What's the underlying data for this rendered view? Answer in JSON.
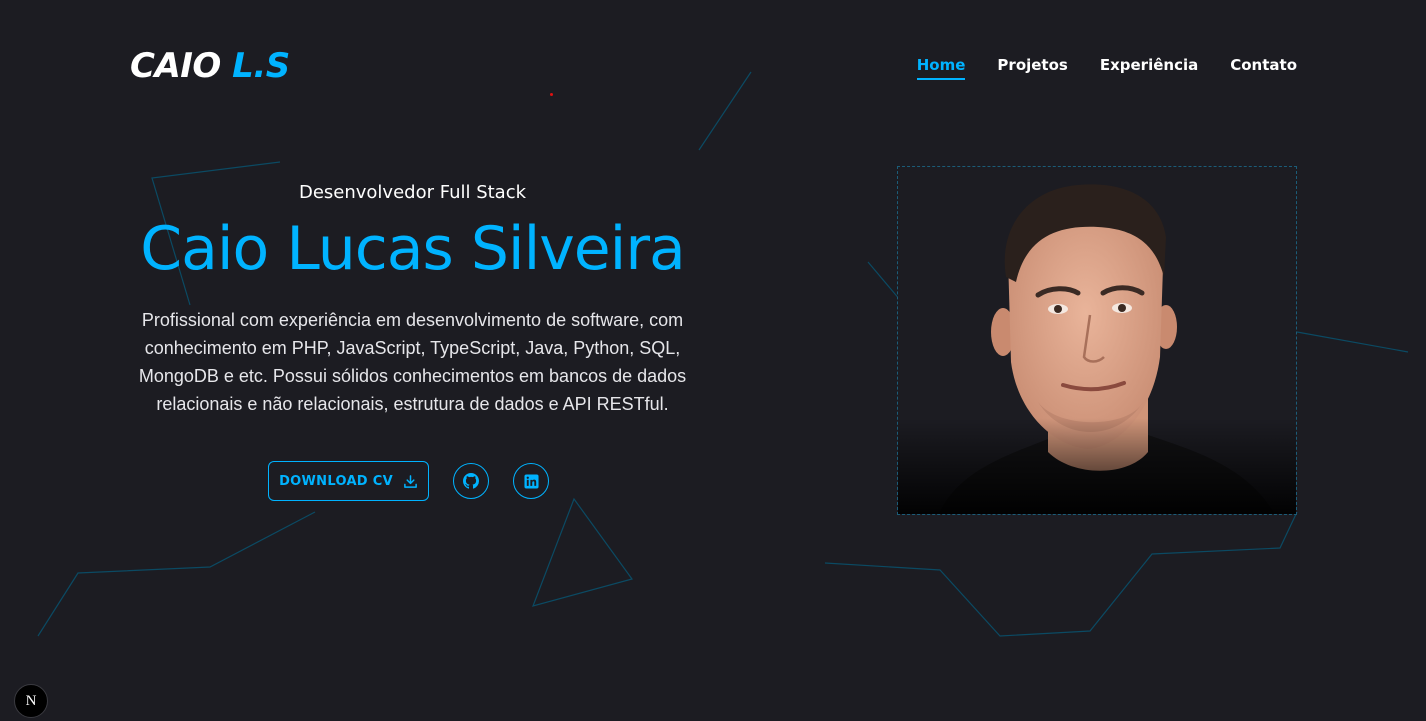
{
  "logo": {
    "first": "CAIO",
    "accent": "L.S"
  },
  "nav": {
    "items": [
      {
        "label": "Home",
        "active": true
      },
      {
        "label": "Projetos",
        "active": false
      },
      {
        "label": "Experiência",
        "active": false
      },
      {
        "label": "Contato",
        "active": false
      }
    ]
  },
  "hero": {
    "role": "Desenvolvedor Full Stack",
    "name": "Caio Lucas Silveira",
    "bio": "Profissional com experiência em desenvolvimento de software, com conhecimento em PHP, JavaScript, TypeScript, Java, Python, SQL, MongoDB e etc. Possui sólidos conhecimentos em bancos de dados relacionais e não relacionais, estrutura de dados e API RESTful.",
    "download_label": "DOWNLOAD CV",
    "social": [
      "github-icon",
      "linkedin-icon"
    ]
  },
  "colors": {
    "accent": "#00b3ff",
    "background": "#1c1c22",
    "line": "#0b4a63"
  },
  "dev_badge": "N"
}
